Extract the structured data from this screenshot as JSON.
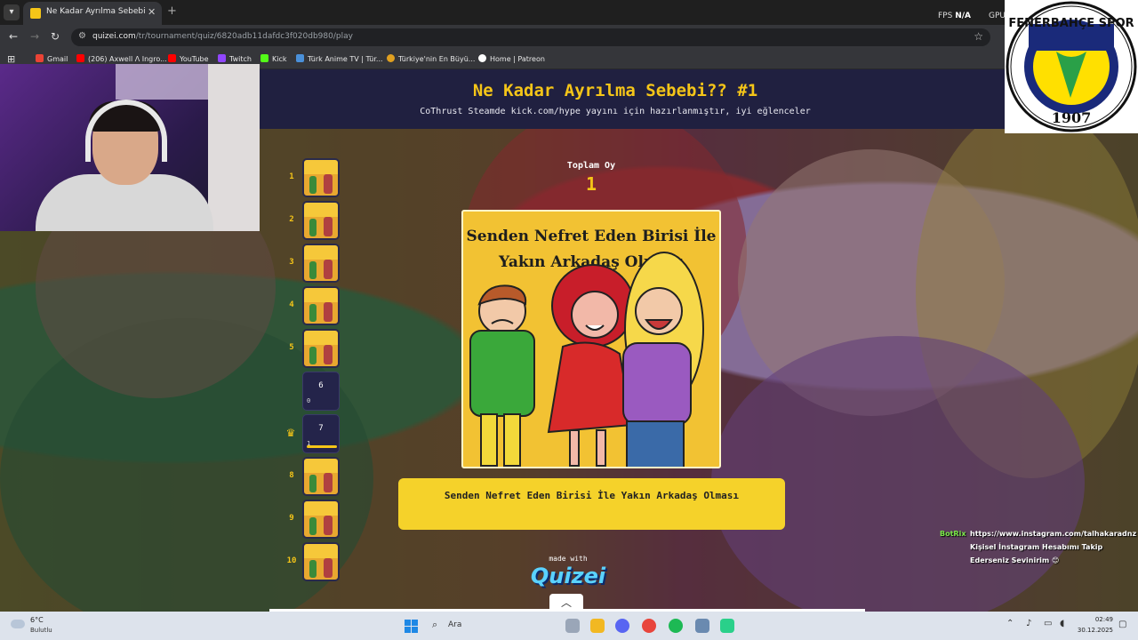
{
  "browser": {
    "tab_title": "Ne Kadar Ayrılma Sebebi?? #1 ·",
    "tab_close": "✕",
    "new_tab": "+",
    "fps_label": "FPS",
    "fps_value": "N/A",
    "gpu_label": "GPU",
    "url_host": "quizei.com",
    "url_path": "/tr/tournament/quiz/6820adb11dafdc3f020db980/play",
    "bookmarks": [
      "Gmail",
      "(206) Axwell Λ Ingro...",
      "YouTube",
      "Twitch",
      "Kick",
      "Türk Anime TV | Tür...",
      "Türkiye'nin En Büyü...",
      "Home | Patreon"
    ]
  },
  "quiz": {
    "title": "Ne Kadar Ayrılma Sebebi?? #1",
    "subtitle": "CoThrust Steamde kick.com/hype yayını için hazırlanmıştır, iyi eğlenceler",
    "total_label": "Toplam Oy",
    "total_value": "1",
    "rail": [
      {
        "num": "1"
      },
      {
        "num": "2"
      },
      {
        "num": "3"
      },
      {
        "num": "4"
      },
      {
        "num": "5"
      },
      {
        "num": "",
        "inner": "6",
        "votes": "0"
      },
      {
        "num": "",
        "inner": "7",
        "votes": "1",
        "crown": "♛"
      },
      {
        "num": "8"
      },
      {
        "num": "9"
      },
      {
        "num": "10"
      }
    ],
    "card_text": "Senden Nefret Eden Birisi İle Yakın Arkadaş Olması",
    "answer_text": "Senden Nefret Eden Birisi İle Yakın Arkadaş Olması",
    "made_with": "made with",
    "brand": "Quizei"
  },
  "chat": {
    "user": "BotRix",
    "message": "https://www.instagram.com/talhakaradnz Kişisel İnstagram Hesabımı Takip Ederseniz Sevinirim 😊"
  },
  "taskbar": {
    "temp": "6°C",
    "weather": "Bulutlu",
    "search_label": "Ara",
    "time": "02:49",
    "date": "30.12.2025"
  },
  "colors": {
    "accent": "#f5c518",
    "header_bg": "#202040",
    "chat_user": "#7be84a"
  }
}
